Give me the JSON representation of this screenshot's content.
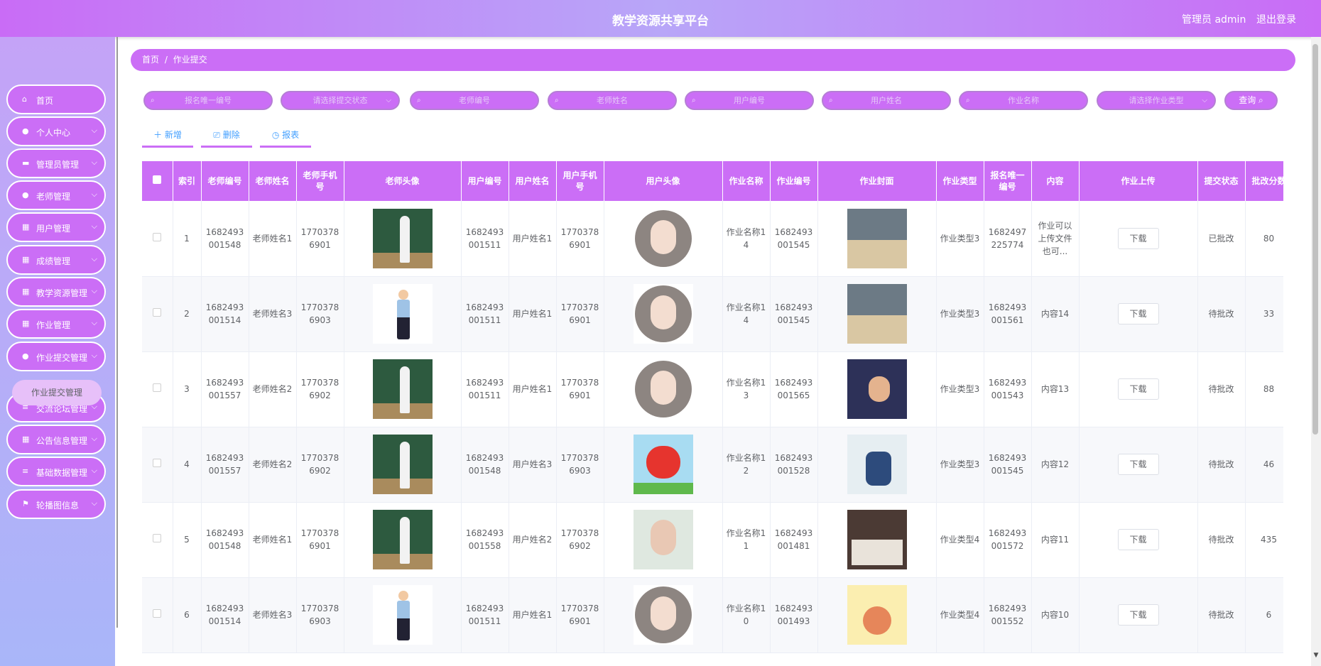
{
  "header": {
    "title": "教学资源共享平台",
    "admin": "管理员 admin",
    "logout": "退出登录"
  },
  "sidebar": {
    "items": [
      {
        "label": "首页",
        "icon": "⌂",
        "arrow": ""
      },
      {
        "label": "个人中心",
        "icon": "●",
        "arrow": "⌵"
      },
      {
        "label": "管理员管理",
        "icon": "▬",
        "arrow": "⌵"
      },
      {
        "label": "老师管理",
        "icon": "●",
        "arrow": "⌵"
      },
      {
        "label": "用户管理",
        "icon": "▦",
        "arrow": "⌵"
      },
      {
        "label": "成绩管理",
        "icon": "▦",
        "arrow": "⌵"
      },
      {
        "label": "教学资源管理",
        "icon": "▦",
        "arrow": "⌵"
      },
      {
        "label": "作业管理",
        "icon": "▦",
        "arrow": "⌵"
      },
      {
        "label": "作业提交管理",
        "icon": "●",
        "arrow": "⌵"
      },
      {
        "label": "交流论坛管理",
        "icon": "≡",
        "arrow": "⌵"
      },
      {
        "label": "公告信息管理",
        "icon": "▦",
        "arrow": "⌵"
      },
      {
        "label": "基础数据管理",
        "icon": "≡",
        "arrow": "⌵"
      },
      {
        "label": "轮播图信息",
        "icon": "⚑",
        "arrow": "⌵"
      }
    ],
    "submenu": "作业提交管理"
  },
  "breadcrumb": {
    "home": "首页",
    "sep": "/",
    "current": "作业提交"
  },
  "search": [
    {
      "placeholder": "报名唯一编号",
      "type": "input"
    },
    {
      "placeholder": "请选择提交状态",
      "type": "select"
    },
    {
      "placeholder": "老师编号",
      "type": "input"
    },
    {
      "placeholder": "老师姓名",
      "type": "input"
    },
    {
      "placeholder": "用户编号",
      "type": "input"
    },
    {
      "placeholder": "用户姓名",
      "type": "input"
    },
    {
      "placeholder": "作业名称",
      "type": "input"
    },
    {
      "placeholder": "请选择作业类型",
      "type": "select"
    }
  ],
  "query_label": "查询 ⌕",
  "actions": {
    "add": "＋ 新增",
    "delete": "⎚ 删除",
    "report": "◷ 报表"
  },
  "table": {
    "headers": [
      "索引",
      "老师编号",
      "老师姓名",
      "老师手机号",
      "老师头像",
      "用户编号",
      "用户姓名",
      "用户手机号",
      "用户头像",
      "作业名称",
      "作业编号",
      "作业封面",
      "作业类型",
      "报名唯一编号",
      "内容",
      "作业上传",
      "提交状态",
      "批改分数"
    ],
    "download_label": "下载",
    "rows": [
      {
        "idx": "1",
        "t_no": "1682493001548",
        "t_name": "老师姓名1",
        "t_phone": "17703786901",
        "t_img": "teacher-board",
        "u_no": "1682493001511",
        "u_name": "用户姓名1",
        "u_phone": "17703786901",
        "u_img": "avatar-girl",
        "hw_name": "作业名称14",
        "hw_no": "1682493001545",
        "cover": "cover-1",
        "hw_type": "作业类型3",
        "reg_no": "1682497225774",
        "content": "作业可以上传文件也可...",
        "status": "已批改",
        "score": "80"
      },
      {
        "idx": "2",
        "t_no": "1682493001514",
        "t_name": "老师姓名3",
        "t_phone": "17703786903",
        "t_img": "teacher-white",
        "u_no": "1682493001511",
        "u_name": "用户姓名1",
        "u_phone": "17703786901",
        "u_img": "avatar-girl",
        "hw_name": "作业名称14",
        "hw_no": "1682493001545",
        "cover": "cover-1",
        "hw_type": "作业类型3",
        "reg_no": "1682493001561",
        "content": "内容14",
        "status": "待批改",
        "score": "33"
      },
      {
        "idx": "3",
        "t_no": "1682493001557",
        "t_name": "老师姓名2",
        "t_phone": "17703786902",
        "t_img": "teacher-board",
        "u_no": "1682493001511",
        "u_name": "用户姓名1",
        "u_phone": "17703786901",
        "u_img": "avatar-girl",
        "hw_name": "作业名称13",
        "hw_no": "1682493001565",
        "cover": "cover-2",
        "hw_type": "作业类型3",
        "reg_no": "1682493001543",
        "content": "内容13",
        "status": "待批改",
        "score": "88"
      },
      {
        "idx": "4",
        "t_no": "1682493001557",
        "t_name": "老师姓名2",
        "t_phone": "17703786902",
        "t_img": "teacher-board",
        "u_no": "1682493001548",
        "u_name": "用户姓名3",
        "u_phone": "17703786903",
        "u_img": "avatar-cartoon",
        "hw_name": "作业名称12",
        "hw_no": "1682493001528",
        "cover": "cover-3",
        "hw_type": "作业类型3",
        "reg_no": "1682493001545",
        "content": "内容12",
        "status": "待批改",
        "score": "46"
      },
      {
        "idx": "5",
        "t_no": "1682493001548",
        "t_name": "老师姓名1",
        "t_phone": "17703786901",
        "t_img": "teacher-board",
        "u_no": "1682493001558",
        "u_name": "用户姓名2",
        "u_phone": "17703786902",
        "u_img": "avatar-photo",
        "hw_name": "作业名称11",
        "hw_no": "1682493001481",
        "cover": "cover-4",
        "hw_type": "作业类型4",
        "reg_no": "1682493001572",
        "content": "内容11",
        "status": "待批改",
        "score": "435"
      },
      {
        "idx": "6",
        "t_no": "1682493001514",
        "t_name": "老师姓名3",
        "t_phone": "17703786903",
        "t_img": "teacher-white",
        "u_no": "1682493001511",
        "u_name": "用户姓名1",
        "u_phone": "17703786901",
        "u_img": "avatar-girl",
        "hw_name": "作业名称10",
        "hw_no": "1682493001493",
        "cover": "cover-5",
        "hw_type": "作业类型4",
        "reg_no": "1682493001552",
        "content": "内容10",
        "status": "待批改",
        "score": "6"
      }
    ]
  }
}
